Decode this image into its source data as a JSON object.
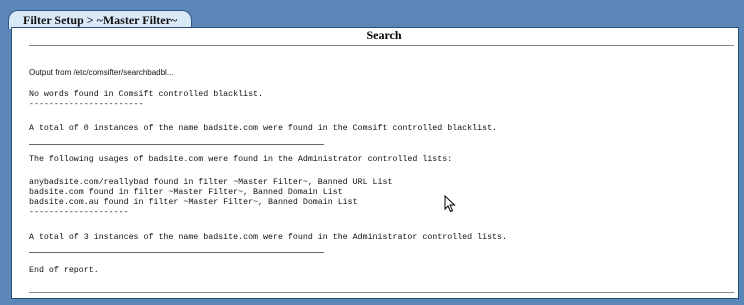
{
  "tab": {
    "label": "Filter Setup > ~Master Filter~"
  },
  "panel": {
    "heading": "Search",
    "intro": "Output from /etc/comsifter/searchbadbl...",
    "lines": [
      "No words found in Comsift controlled blacklist.",
      "-----------------------",
      "A total of 0 instances of the name badsite.com were found in the Comsift controlled blacklist.",
      "The following usages of badsite.com were found in the Administrator controlled lists:",
      "anybadsite.com/reallybad found in filter ~Master Filter~, Banned URL List",
      "badsite.com found in filter ~Master Filter~, Banned Domain List",
      "badsite.com.au found in filter ~Master Filter~, Banned Domain List",
      "--------------------",
      "A total of 3 instances of the name badsite.com were found in the Administrator controlled lists.",
      "End of report."
    ]
  },
  "icons": {
    "cursor": "mouse-pointer-icon"
  }
}
